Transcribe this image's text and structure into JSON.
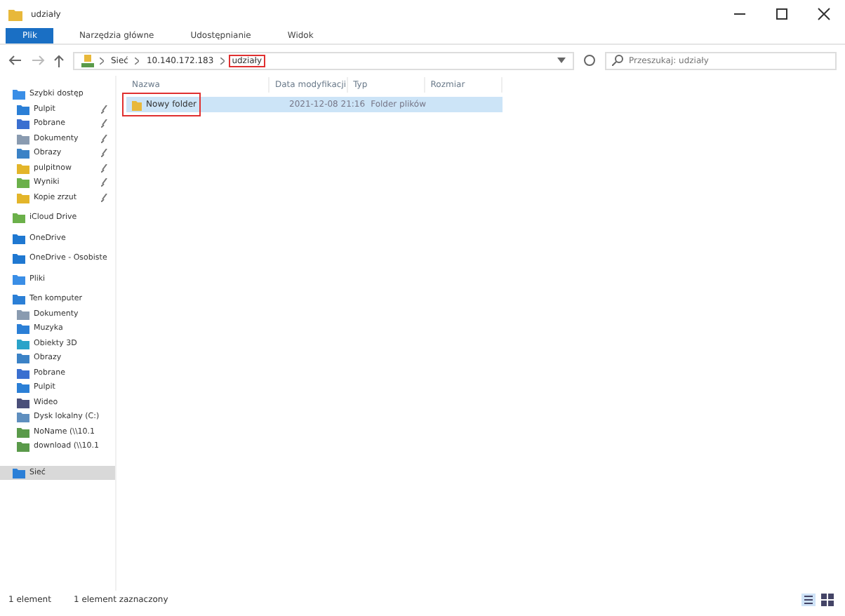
{
  "window": {
    "title": "udziały"
  },
  "ribbon_tabs": [
    {
      "label": "Plik",
      "selected": true
    },
    {
      "label": "Narzędzia główne",
      "selected": false
    },
    {
      "label": "Udostępnianie",
      "selected": false
    },
    {
      "label": "Widok",
      "selected": false
    }
  ],
  "breadcrumb": [
    {
      "label": "Sieć",
      "highlighted": false
    },
    {
      "label": "10.140.172.183",
      "highlighted": false
    },
    {
      "label": "udziały",
      "highlighted": true
    }
  ],
  "search": {
    "placeholder": "Przeszukaj: udziały"
  },
  "sidebar": {
    "items": [
      {
        "label": "Szybki dostęp",
        "pinned": false,
        "selected": false,
        "group": true,
        "color": "#3a8ee6"
      },
      {
        "label": "Pulpit",
        "pinned": true,
        "selected": false,
        "group": false,
        "color": "#2b7fd6"
      },
      {
        "label": "Pobrane",
        "pinned": true,
        "selected": false,
        "group": false,
        "color": "#3a6fd0"
      },
      {
        "label": "Dokumenty",
        "pinned": true,
        "selected": false,
        "group": false,
        "color": "#8a9bb0"
      },
      {
        "label": "Obrazy",
        "pinned": true,
        "selected": false,
        "group": false,
        "color": "#3b82c6"
      },
      {
        "label": "pulpitnow",
        "pinned": true,
        "selected": false,
        "group": false,
        "color": "#e3b52a"
      },
      {
        "label": "Wyniki",
        "pinned": true,
        "selected": false,
        "group": false,
        "color": "#6bb04a"
      },
      {
        "label": "Kopie zrzut",
        "pinned": true,
        "selected": false,
        "group": false,
        "color": "#e3b52a"
      },
      {
        "label": "iCloud Drive",
        "pinned": false,
        "selected": false,
        "group": true,
        "color": "#6bb04a"
      },
      {
        "label": "OneDrive",
        "pinned": false,
        "selected": false,
        "group": true,
        "color": "#1f78d1"
      },
      {
        "label": "OneDrive - Osobiste",
        "pinned": false,
        "selected": false,
        "group": true,
        "color": "#1f78d1"
      },
      {
        "label": "Pliki",
        "pinned": false,
        "selected": false,
        "group": true,
        "color": "#3a8ee6"
      },
      {
        "label": "Ten komputer",
        "pinned": false,
        "selected": false,
        "group": true,
        "color": "#2b7fd6"
      },
      {
        "label": "Dokumenty",
        "pinned": false,
        "selected": false,
        "group": false,
        "color": "#8a9bb0"
      },
      {
        "label": "Muzyka",
        "pinned": false,
        "selected": false,
        "group": false,
        "color": "#2b7fd6"
      },
      {
        "label": "Obiekty 3D",
        "pinned": false,
        "selected": false,
        "group": false,
        "color": "#2aa3c9"
      },
      {
        "label": "Obrazy",
        "pinned": false,
        "selected": false,
        "group": false,
        "color": "#3b82c6"
      },
      {
        "label": "Pobrane",
        "pinned": false,
        "selected": false,
        "group": false,
        "color": "#3a6fd0"
      },
      {
        "label": "Pulpit",
        "pinned": false,
        "selected": false,
        "group": false,
        "color": "#2b7fd6"
      },
      {
        "label": "Wideo",
        "pinned": false,
        "selected": false,
        "group": false,
        "color": "#4a4f7a"
      },
      {
        "label": "Dysk lokalny (C:)",
        "pinned": false,
        "selected": false,
        "group": false,
        "color": "#5f8fbf"
      },
      {
        "label": "NoName (\\\\10.1",
        "pinned": false,
        "selected": false,
        "group": false,
        "color": "#5a9a4a"
      },
      {
        "label": "download (\\\\10.1",
        "pinned": false,
        "selected": false,
        "group": false,
        "color": "#5a9a4a"
      },
      {
        "label": "Sieć",
        "pinned": false,
        "selected": true,
        "group": true,
        "color": "#2b7fd7"
      }
    ]
  },
  "table": {
    "columns": [
      "Nazwa",
      "Data modyfikacji",
      "Typ",
      "Rozmiar"
    ],
    "rows": [
      {
        "name": "Nowy folder",
        "date": "2021-12-08 21:16",
        "type": "Folder plików",
        "selected": true,
        "highlighted": true
      }
    ]
  },
  "status_bar": {
    "count": "1 element",
    "selection": "1 element zaznaczony"
  }
}
